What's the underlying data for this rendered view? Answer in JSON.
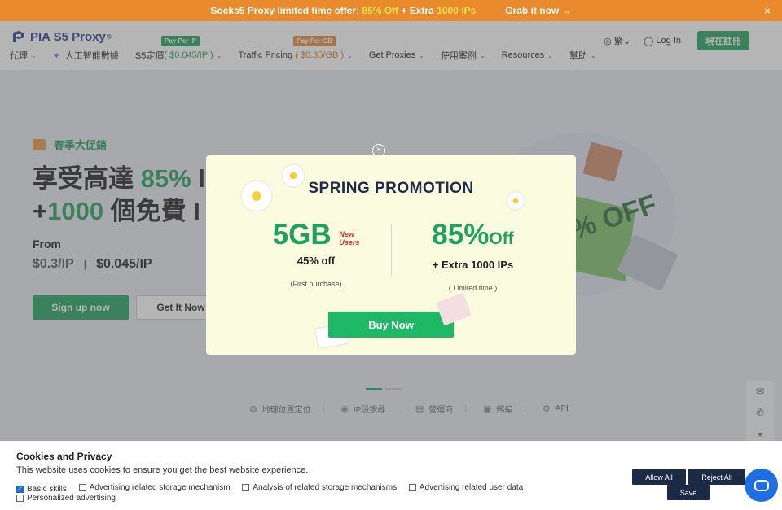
{
  "top_banner": {
    "part1": "Socks5 Proxy limited time offer:",
    "highlight1": "85% Off",
    "part2": "+ Extra",
    "highlight2": "1000 IPs",
    "grab": "Grab it now →",
    "close": "×"
  },
  "header": {
    "logo_text": "PIA S5 Proxy",
    "logo_reg": "®",
    "nav": {
      "item1": "代理",
      "item2": "人工智能數據",
      "item3_label": "S5定價",
      "item3_sub": "( $0.045/IP )",
      "item3_badge": "Pay Per IP",
      "item4_label": "Traffic Pricing",
      "item4_sub": "( $0.35/GB )",
      "item4_badge": "Pay Per GB",
      "item5": "Get Proxies",
      "item6": "使用案例",
      "item7": "Resources",
      "item8": "幫助"
    },
    "lang": "繁",
    "login": "Log In",
    "register": "現在註冊"
  },
  "hero": {
    "tag": "春季大促銷",
    "line1_prefix": "享受高達",
    "line1_green": "85%",
    "line1_rest": "l",
    "line2_plus": "+",
    "line2_green": "1000",
    "line2_rest": " 個免費 I",
    "from": "From",
    "old_price": "$0.3/IP",
    "separator": "|",
    "new_price": "$0.045/IP",
    "signup": "Sign up now",
    "getit": "Get It Now",
    "art_text": "% OFF"
  },
  "features": {
    "f1": "地理位置定位",
    "f2": "IP段搜尋",
    "f3": "營運商",
    "f4": "郵編",
    "f5": "API"
  },
  "modal": {
    "title": "SPRING PROMOTION",
    "offer1_big": "5GB",
    "offer1_new": "New",
    "offer1_users": "Users",
    "offer1_sub": "45% off",
    "offer1_note": "(First purchase)",
    "offer2_big": "85%",
    "offer2_off": "Off",
    "offer2_sub": "+ Extra 1000 IPs",
    "offer2_note": "( Limited time )",
    "buy": "Buy Now",
    "close": "×"
  },
  "cookie": {
    "title": "Cookies and Privacy",
    "desc": "This website uses cookies to ensure you get the best website experience.",
    "opt1": "Basic skills",
    "opt2": "Advertising related storage mechanism",
    "opt3": "Analysis of related storage mechanisms",
    "opt4": "Advertising related user data",
    "opt5": "Personalized advertising",
    "allow": "Allow All",
    "reject": "Reject All",
    "save": "Save"
  },
  "colors": {
    "brand_green": "#1fa35b",
    "banner_orange": "#e98a2d",
    "cookie_button": "#1b2a45",
    "chat_blue": "#1f6ee3"
  }
}
